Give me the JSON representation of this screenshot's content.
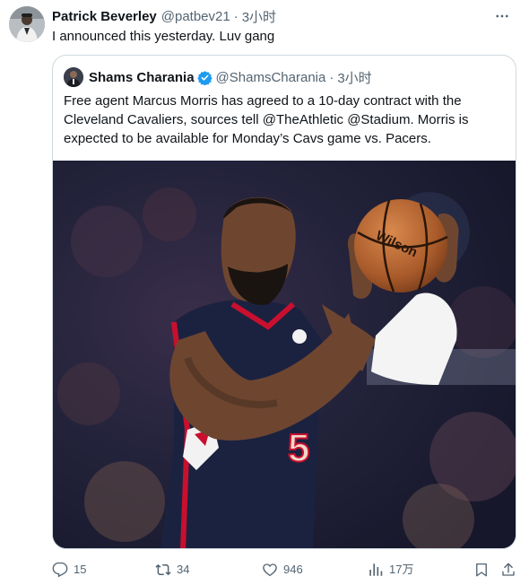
{
  "tweet": {
    "author_name": "Patrick Beverley",
    "author_handle": "@patbev21",
    "separator": "·",
    "time": "3小时",
    "text": "I announced this yesterday. Luv gang",
    "avatar_icon": "avatar-photo"
  },
  "quote": {
    "author_name": "Shams Charania",
    "author_handle": "@ShamsCharania",
    "separator": "·",
    "time": "3小时",
    "verified": true,
    "verified_color": "#1d9bf0",
    "text": "Free agent Marcus Morris has agreed to a 10-day contract with the Cleveland Cavaliers, sources tell @TheAthletic @Stadium. Morris is expected to be available for Monday’s Cavs game vs. Pacers.",
    "media": {
      "kind": "photo",
      "jersey_number": "5",
      "ball_brand": "Wilson"
    }
  },
  "actions": {
    "reply_count": "15",
    "retweet_count": "34",
    "like_count": "946",
    "views_count": "17万",
    "icons": [
      "reply-icon",
      "retweet-icon",
      "like-icon",
      "views-icon",
      "bookmark-icon",
      "share-icon"
    ]
  },
  "colors": {
    "text_primary": "#0f1419",
    "text_secondary": "#536471",
    "border": "#cfd9de",
    "jersey_navy": "#1b2240",
    "jersey_red": "#c8102e"
  }
}
